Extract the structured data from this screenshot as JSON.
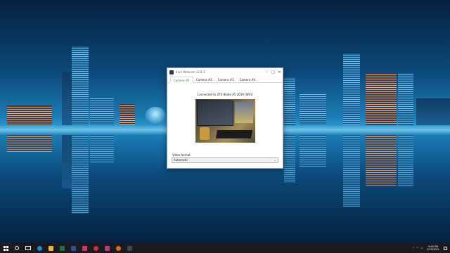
{
  "window": {
    "title": "Iriun Webcam v2.8.3",
    "min": "–",
    "max": "□",
    "close": "✕"
  },
  "tabs": [
    {
      "label": "Camera #1",
      "active": true
    },
    {
      "label": "Camera #2",
      "active": false
    },
    {
      "label": "Camera #3",
      "active": false
    },
    {
      "label": "Camera #4",
      "active": false
    }
  ],
  "status": "Connected to ZTE Blade A5 2019 [WiFi]",
  "video_format": {
    "label": "Video format",
    "selected": "Automatic",
    "arrow": "⌄"
  },
  "taskbar": {
    "search_glyph": "○",
    "tray_arrow": "^",
    "time": "9:46 PM",
    "date": "3/25/2021",
    "accent": "#2b8a2b"
  }
}
